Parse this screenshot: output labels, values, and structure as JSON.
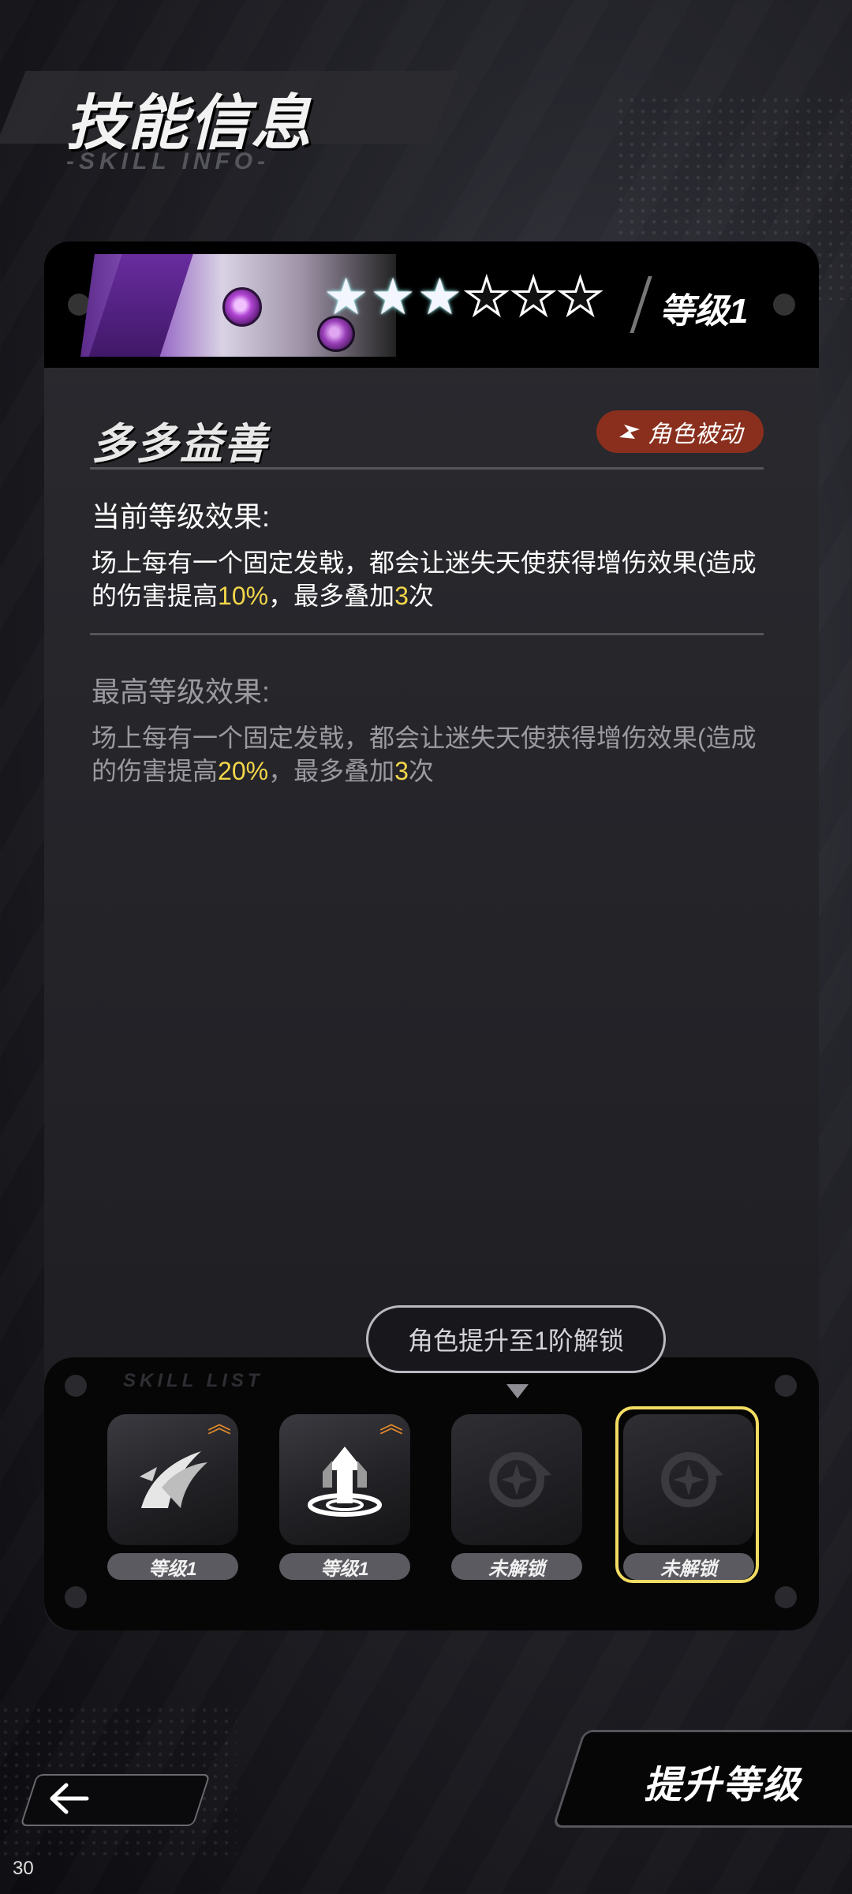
{
  "header": {
    "title": "技能信息",
    "subtitle": "-SKILL INFO-"
  },
  "skill_card": {
    "stars_filled": 3,
    "stars_total": 6,
    "level_label": "等级1",
    "skill_name": "多多益善",
    "tag_label": "角色被动",
    "current": {
      "title": "当前等级效果:",
      "desc_pre": "场上每有一个固定发戟，都会让迷失天使获得增伤效果(造成的伤害提高",
      "desc_value": "10%",
      "desc_mid": "，最多叠加",
      "desc_count": "3",
      "desc_post": "次"
    },
    "max": {
      "title": "最高等级效果:",
      "desc_pre": "场上每有一个固定发戟，都会让迷失天使获得增伤效果(造成的伤害提高",
      "desc_value": "20%",
      "desc_mid": "，最多叠加",
      "desc_count": "3",
      "desc_post": "次"
    }
  },
  "tooltip": {
    "text": "角色提升至1阶解锁"
  },
  "skill_list": {
    "label": "SKILL LIST",
    "slots": [
      {
        "label": "等级1",
        "icon": "slash-icon",
        "upgradable": true,
        "locked": false
      },
      {
        "label": "等级1",
        "icon": "arrow-up-ring-icon",
        "upgradable": true,
        "locked": false
      },
      {
        "label": "未解锁",
        "icon": "locked-skill-icon",
        "upgradable": false,
        "locked": true
      },
      {
        "label": "未解锁",
        "icon": "locked-skill-icon",
        "upgradable": false,
        "locked": true,
        "selected": true
      }
    ]
  },
  "buttons": {
    "upgrade_label": "提升等级"
  },
  "status": {
    "fps": "30"
  },
  "colors": {
    "accent_yellow": "#f2d64a",
    "tag_red": "#8a2f1d",
    "upgrade_orange": "#e58a2a"
  }
}
